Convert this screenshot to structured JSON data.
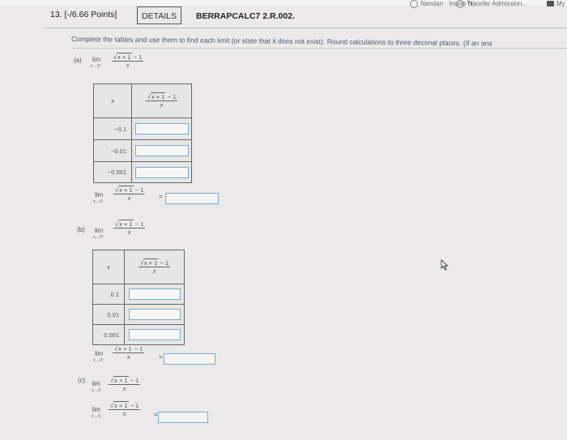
{
  "bookmarks": [
    {
      "label": "Nandan - Inside N..."
    },
    {
      "label": "Transfer Admission..."
    },
    {
      "label": "My"
    }
  ],
  "header": {
    "question_number": "13.",
    "points": "[-/6.66 Points]",
    "details_tab": "DETAILS",
    "question_code": "BERRAPCALC7 2.R.002."
  },
  "instructions": "Complete the tables and use them to find each limit (or state that it does not exist). Round calculations to three decimal places. (If an ans",
  "expression": {
    "lim": "lim",
    "numerator": "√x + 1 − 1",
    "radicand": "x + 1",
    "minus_one": "− 1",
    "denominator": "x",
    "equals": "="
  },
  "parts": {
    "a": {
      "label": "(a)",
      "approach": "x→0⁻",
      "table_header_x": "x",
      "x_values": [
        "−0.1",
        "−0.01",
        "−0.001"
      ]
    },
    "b": {
      "label": "(b)",
      "approach": "x→0⁺",
      "table_header_x": "x",
      "x_values": [
        "0.1",
        "0.01",
        "0.001"
      ]
    },
    "c": {
      "label": "(c)",
      "approach": "x→0"
    }
  },
  "colors": {
    "background": "#ebe9ea",
    "input_border": "#7aaec9",
    "instruction_text": "#4b5a6e"
  }
}
